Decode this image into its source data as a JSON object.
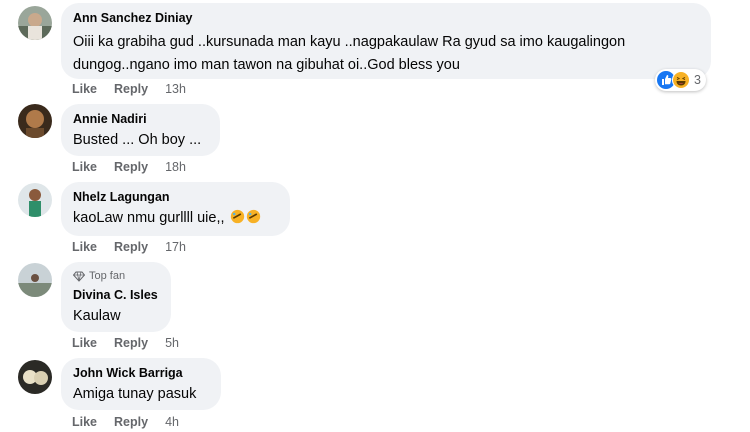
{
  "comments": [
    {
      "author": "Ann Sanchez Diniay",
      "text_line1": "Oiii ka grabiha gud ..kursunada man kayu ..nagpakaulaw Ra gyud sa imo kaugalingon",
      "text_line2": "dungog..ngano imo man tawon na gibuhat oi..God bless you",
      "like": "Like",
      "reply": "Reply",
      "time": "13h",
      "reaction_count": "3",
      "avatar_icon": "profile-photo"
    },
    {
      "author": "Annie Nadiri",
      "text": "Busted ... Oh boy ...",
      "like": "Like",
      "reply": "Reply",
      "time": "18h",
      "avatar_icon": "profile-photo"
    },
    {
      "author": "Nhelz Lagungan",
      "text": "kaoLaw nmu gurllll uie,,",
      "emoji": "rolling-on-floor-laughing-icon",
      "like": "Like",
      "reply": "Reply",
      "time": "17h",
      "avatar_icon": "profile-photo"
    },
    {
      "badge": "Top fan",
      "badge_icon": "diamond-icon",
      "author": "Divina C. Isles",
      "text": "Kaulaw",
      "like": "Like",
      "reply": "Reply",
      "time": "5h",
      "avatar_icon": "profile-photo"
    },
    {
      "author": "John Wick Barriga",
      "text": "Amiga tunay pasuk",
      "like": "Like",
      "reply": "Reply",
      "time": "4h",
      "avatar_icon": "profile-photo"
    }
  ],
  "colors": {
    "bubble": "#f0f2f5",
    "muted": "#65676b",
    "like_blue": "#1877f2",
    "haha_yellow": "#f7b125"
  }
}
